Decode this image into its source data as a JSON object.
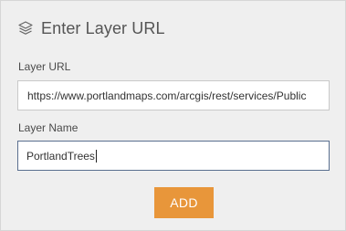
{
  "header": {
    "icon": "layers-icon",
    "title": "Enter Layer URL"
  },
  "layer_url": {
    "label": "Layer URL",
    "value": "https://www.portlandmaps.com/arcgis/rest/services/Public"
  },
  "layer_name": {
    "label": "Layer Name",
    "value": "PortlandTrees"
  },
  "add_button": {
    "label": "ADD",
    "color": "#e8963a"
  }
}
